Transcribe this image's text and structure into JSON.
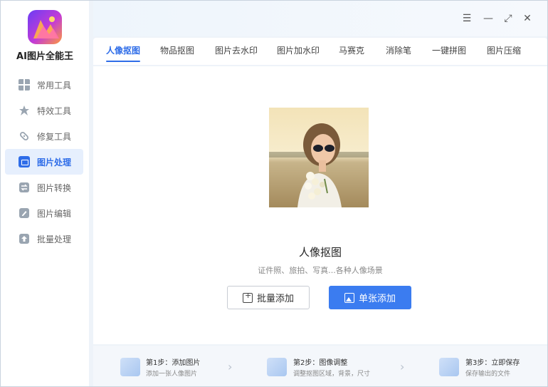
{
  "app": {
    "name": "AI图片全能王"
  },
  "sidebar": {
    "items": [
      {
        "label": "常用工具",
        "icon": "grid-icon"
      },
      {
        "label": "特效工具",
        "icon": "magic-star-icon"
      },
      {
        "label": "修复工具",
        "icon": "bandage-icon"
      },
      {
        "label": "图片处理",
        "icon": "image-wave-icon",
        "active": true
      },
      {
        "label": "图片转换",
        "icon": "convert-icon"
      },
      {
        "label": "图片编辑",
        "icon": "edit-icon"
      },
      {
        "label": "批量处理",
        "icon": "upload-icon"
      }
    ]
  },
  "window_controls": {
    "menu": "☰",
    "minimize": "—",
    "maximize": "⤢",
    "close": "✕"
  },
  "tabs": [
    "人像抠图",
    "物品抠图",
    "图片去水印",
    "图片加水印",
    "马赛克",
    "消除笔",
    "一键拼图",
    "图片压缩"
  ],
  "main": {
    "title": "人像抠图",
    "subtitle": "证件照、旅拍、写真...各种人像场景",
    "batch_button": "批量添加",
    "single_button": "单张添加"
  },
  "steps": [
    {
      "title": "第1步：添加图片",
      "desc": "添加一张人像图片"
    },
    {
      "title": "第2步：图像调整",
      "desc": "调整抠图区域，背景，尺寸"
    },
    {
      "title": "第3步：立即保存",
      "desc": "保存输出的文件"
    }
  ],
  "colors": {
    "accent": "#3b7cf0",
    "active_tab": "#2f6de8",
    "sidebar_active_bg": "#e6effd"
  }
}
